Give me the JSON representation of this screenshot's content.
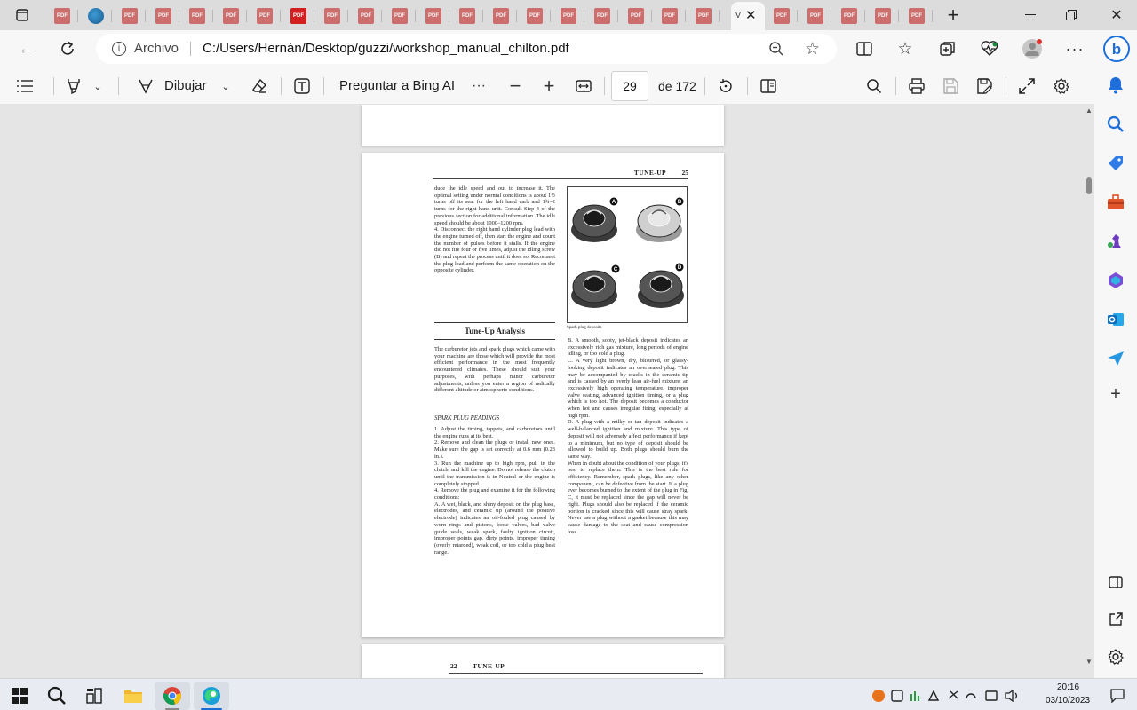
{
  "browser": {
    "active_tab_title": "V",
    "tab_badge": "PDF",
    "address": {
      "prefix": "Archivo",
      "url": "C:/Users/Hernán/Desktop/guzzi/workshop_manual_chilton.pdf"
    }
  },
  "pdf_toolbar": {
    "draw_label": "Dibujar",
    "ask_label": "Preguntar a Bing AI",
    "page_current": "29",
    "page_total_label": "de 172"
  },
  "document": {
    "page_header": "TUNE-UP",
    "page_number": "25",
    "left_column_top": "duce the idle speed and out to increase it. The optimal setting under normal conditions is about 1½ turns off its seat for the left hand carb and 1¾–2 turns for the right hand unit. Consult Step 4 of the previous section for additional information. The idle speed should be about 1000–1200 rpm.\n4. Disconnect the right hand cylinder plug lead with the engine turned off, then start the engine and count the number of pulses before it stalls. If the engine did not fire four or five times, adjust the idling screw (B) and repeat the process until it does so. Reconnect the plug lead and perform the same operation on the opposite cylinder.",
    "section_title": "Tune-Up Analysis",
    "section_intro": "The carburetor jets and spark plugs which came with your machine are those which will provide the most efficient performance in the most frequently encountered climates. These should suit your purposes, with perhaps minor carburetor adjustments, unless you enter a region of radically different altitude or atmospheric conditions.",
    "subsection_title": "SPARK PLUG READINGS",
    "left_column_steps": "1. Adjust the timing, tappets, and carburetors until the engine runs at its best.\n2. Remove and clean the plugs or install new ones. Make sure the gap is set correctly at 0.6 mm (0.23 in.).\n3. Run the machine up to high rpm, pull in the clutch, and kill the engine. Do not release the clutch until the transmission is in Neutral or the engine is completely stopped.\n4. Remove the plug and examine it for the following conditions:\nA. A wet, black, and shiny deposit on the plug base, electrodes, and ceramic tip (around the positive electrode) indicates an oil-fouled plug caused by worn rings and pistons, loose valves, bad valve guide seals, weak spark, faulty ignition circuit, improper points gap, dirty points, improper timing (overly retarded), weak coil, or too cold a plug heat range.",
    "figure_labels": [
      "A",
      "B",
      "C",
      "D"
    ],
    "figure_caption": "Spark plug deposits",
    "right_column_text": "B. A smooth, sooty, jet-black deposit indicates an excessively rich gas mixture, long periods of engine idling, or too cold a plug.\nC. A very light brown, dry, blistered, or glassy-looking deposit indicates an overheated plug. This may be accompanied by cracks in the ceramic tip and is caused by an overly lean air-fuel mixture, an excessively high operating temperature, improper valve seating, advanced ignition timing, or a plug which is too hot. The deposit becomes a conductor when hot and causes irregular firing, especially at high rpm.\nD. A plug with a milky or tan deposit indicates a well-balanced ignition and mixture. This type of deposit will not adversely affect performance if kept to a minimum, but no type of deposit should be allowed to build up. Both plugs should burn the same way.\nWhen in doubt about the condition of your plugs, it's best to replace them. This is the best rule for efficiency. Remember, spark plugs, like any other component, can be defective from the start. If a plug ever becomes burned to the extent of the plug in Fig. C, it must be replaced since the gap will never be right. Plugs should also be replaced if the ceramic portion is cracked since this will cause stray spark. Never use a plug without a gasket because this may cause damage to the seat and cause compression loss.",
    "next_page_number": "22",
    "next_page_header": "TUNE-UP"
  },
  "taskbar": {
    "time": "20:16",
    "date": "03/10/2023"
  }
}
